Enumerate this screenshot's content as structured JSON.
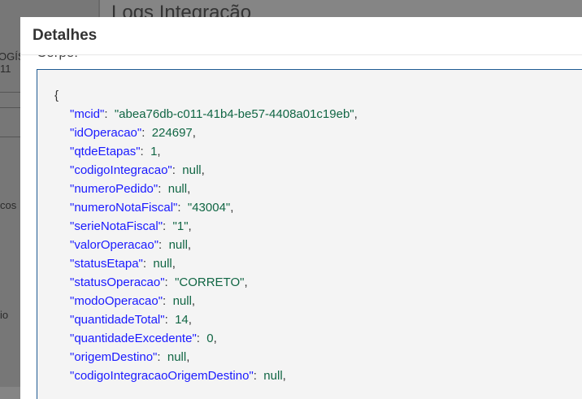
{
  "background": {
    "page_title": "Logs Integração",
    "sidebar_fragments": [
      "OGÍS",
      "11",
      "cos",
      "io"
    ]
  },
  "modal": {
    "title": "Detalhes",
    "section_label": "Corpo:",
    "json_lines": [
      {
        "key": "\"mcid\"",
        "value": "\"abea76db-c011-41b4-be57-4408a01c19eb\""
      },
      {
        "key": "\"idOperacao\"",
        "value": "224697"
      },
      {
        "key": "\"qtdeEtapas\"",
        "value": "1"
      },
      {
        "key": "\"codigoIntegracao\"",
        "value": "null"
      },
      {
        "key": "\"numeroPedido\"",
        "value": "null"
      },
      {
        "key": "\"numeroNotaFiscal\"",
        "value": "\"43004\""
      },
      {
        "key": "\"serieNotaFiscal\"",
        "value": "\"1\""
      },
      {
        "key": "\"valorOperacao\"",
        "value": "null"
      },
      {
        "key": "\"statusEtapa\"",
        "value": "null"
      },
      {
        "key": "\"statusOperacao\"",
        "value": "\"CORRETO\""
      },
      {
        "key": "\"modoOperacao\"",
        "value": "null"
      },
      {
        "key": "\"quantidadeTotal\"",
        "value": "14"
      },
      {
        "key": "\"quantidadeExcedente\"",
        "value": "0"
      },
      {
        "key": "\"origemDestino\"",
        "value": "null"
      },
      {
        "key": "\"codigoIntegracaoOrigemDestino\"",
        "value": "null"
      }
    ],
    "open_brace": "{"
  },
  "colors": {
    "key": "#1a1aff",
    "value": "#116644",
    "code_border": "#1f5a92"
  }
}
